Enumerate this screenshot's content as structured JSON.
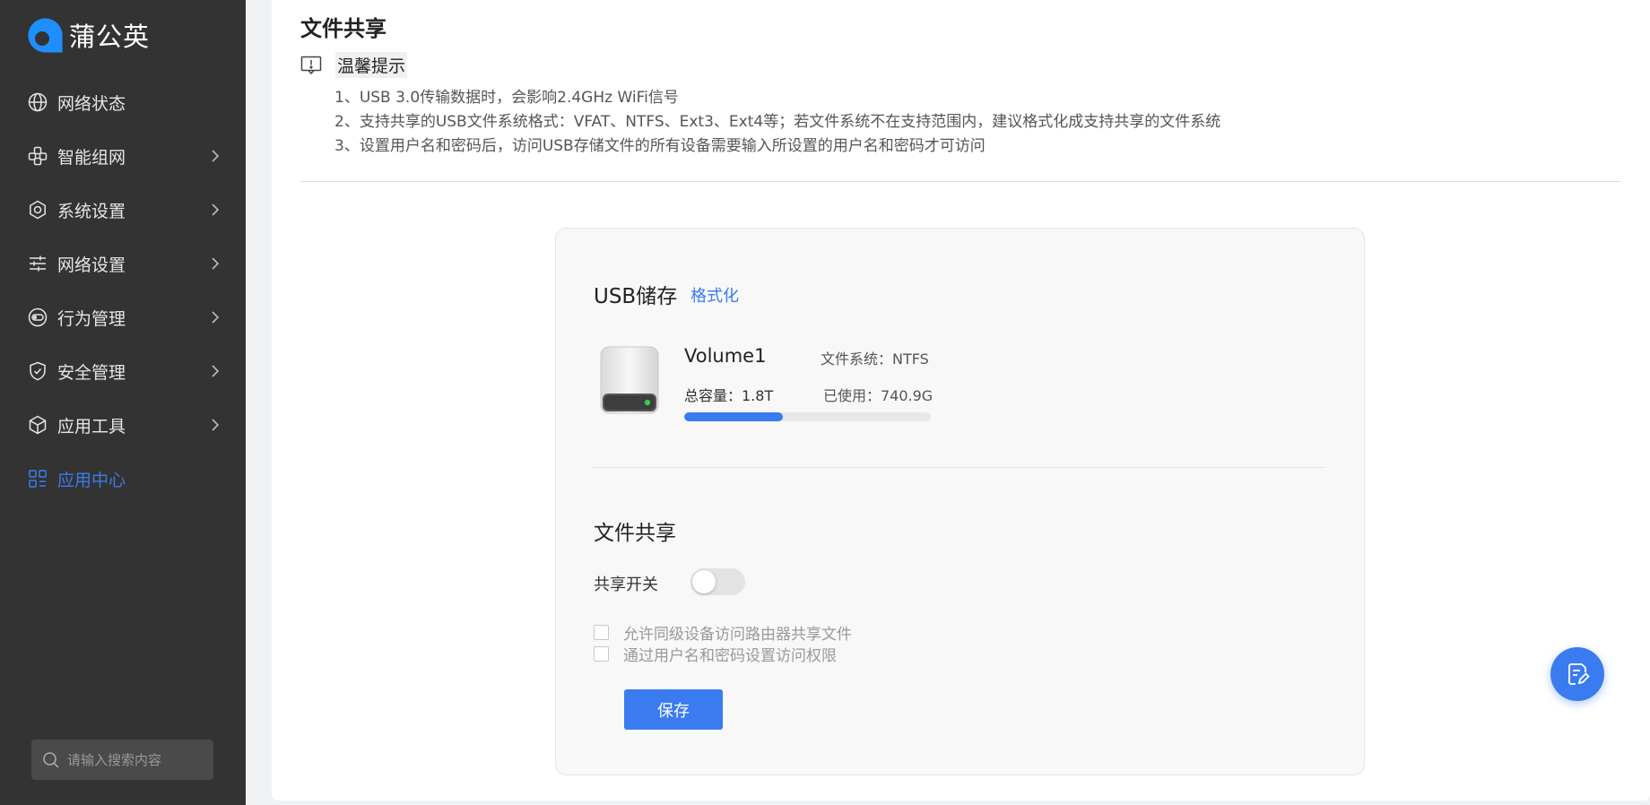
{
  "brand": {
    "name": "蒲公英"
  },
  "sidebar": {
    "items": [
      {
        "label": "网络状态",
        "icon": "globe-icon",
        "has_arrow": false
      },
      {
        "label": "智能组网",
        "icon": "network-nodes-icon",
        "has_arrow": true
      },
      {
        "label": "系统设置",
        "icon": "gear-icon",
        "has_arrow": true
      },
      {
        "label": "网络设置",
        "icon": "sliders-icon",
        "has_arrow": true
      },
      {
        "label": "行为管理",
        "icon": "behavior-icon",
        "has_arrow": true
      },
      {
        "label": "安全管理",
        "icon": "shield-icon",
        "has_arrow": true
      },
      {
        "label": "应用工具",
        "icon": "cube-icon",
        "has_arrow": true
      },
      {
        "label": "应用中心",
        "icon": "grid-icon",
        "has_arrow": false,
        "active": true
      }
    ],
    "search_placeholder": "请输入搜索内容"
  },
  "page": {
    "title": "文件共享",
    "tip_title": "温馨提示",
    "tips": [
      "1、USB 3.0传输数据时，会影响2.4GHz WiFi信号",
      "2、支持共享的USB文件系统格式：VFAT、NTFS、Ext3、Ext4等；若文件系统不在支持范围内，建议格式化成支持共享的文件系统",
      "3、设置用户名和密码后，访问USB存储文件的所有设备需要输入所设置的用户名和密码才可访问"
    ]
  },
  "usb": {
    "title": "USB储存",
    "format_label": "格式化",
    "volume_name": "Volume1",
    "fs_label": "文件系统：NTFS",
    "capacity_label": "总容量：1.8T",
    "used_label": "已使用：740.9G",
    "used_fraction": 0.4
  },
  "share": {
    "title": "文件共享",
    "switch_label": "共享开关",
    "switch_on": false,
    "options": [
      {
        "label": "允许同级设备访问路由器共享文件",
        "checked": false
      },
      {
        "label": "通过用户名和密码设置访问权限",
        "checked": false
      }
    ],
    "save_label": "保存"
  },
  "colors": {
    "accent": "#3a7cf0",
    "sidebar_bg": "#333333"
  }
}
